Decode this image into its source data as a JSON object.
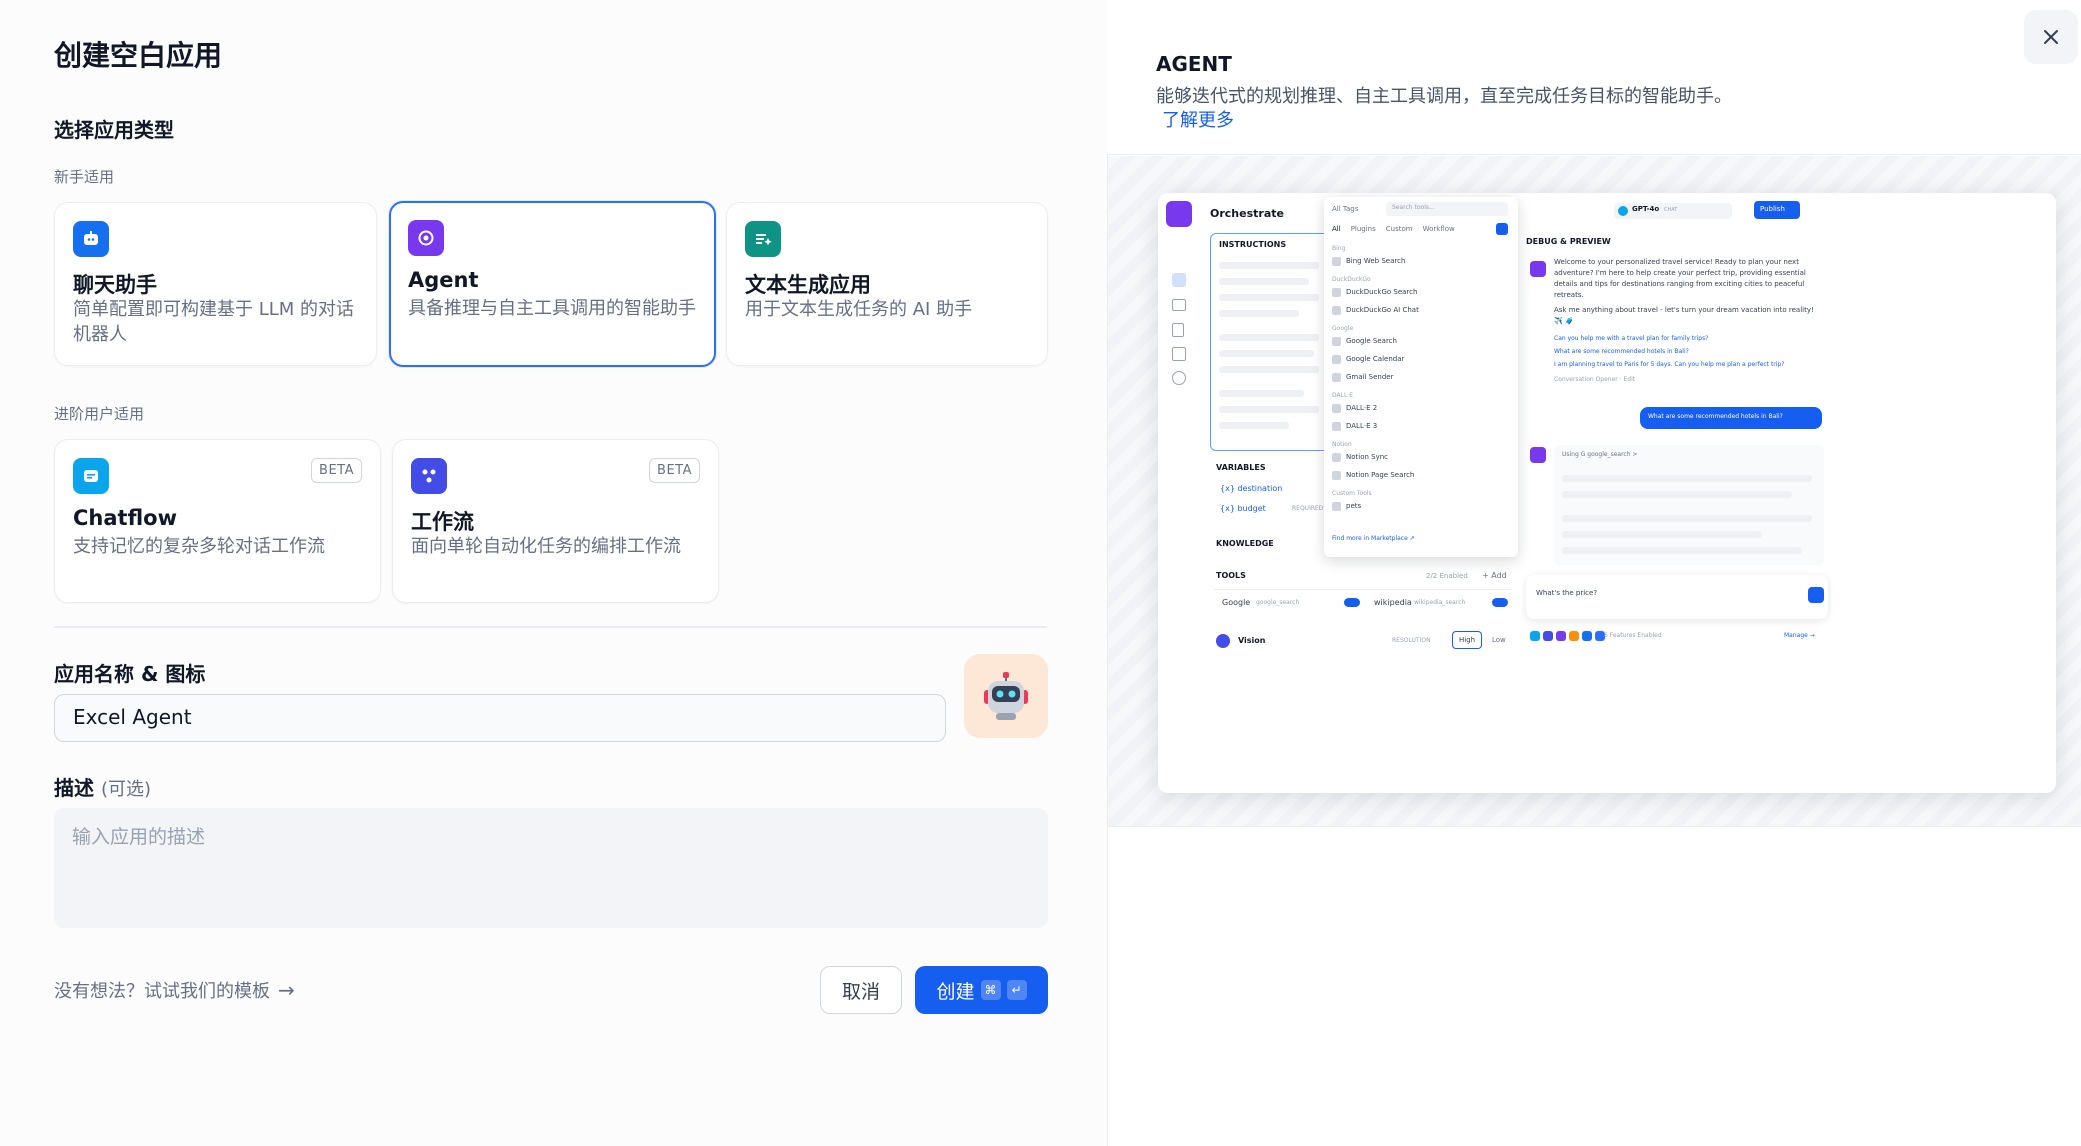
{
  "dialog": {
    "title": "创建空白应用",
    "section_type": "选择应用类型",
    "group_beginner": "新手适用",
    "group_advanced": "进阶用户适用",
    "cards": [
      {
        "name": "聊天助手",
        "desc": "简单配置即可构建基于 LLM 的对话机器人",
        "icon": "chat-bot-icon",
        "color": "#1570ef"
      },
      {
        "name": "Agent",
        "desc": "具备推理与自主工具调用的智能助手",
        "icon": "agent-icon",
        "color": "#7839ee"
      },
      {
        "name": "文本生成应用",
        "desc": "用于文本生成任务的 AI 助手",
        "icon": "text-generation-icon",
        "color": "#0e9384"
      },
      {
        "name": "Chatflow",
        "desc": "支持记忆的复杂多轮对话工作流",
        "icon": "chatflow-icon",
        "color": "#0ba5ec",
        "badge": "BETA"
      },
      {
        "name": "工作流",
        "desc": "面向单轮自动化任务的编排工作流",
        "icon": "workflow-icon",
        "color": "#444ce7",
        "badge": "BETA"
      }
    ],
    "name_label": "应用名称 & 图标",
    "name_value": "Excel Agent",
    "desc_label": "描述",
    "desc_optional": "(可选)",
    "desc_placeholder": "输入应用的描述",
    "template_link": "没有想法？试试我们的模板",
    "cancel": "取消",
    "create": "创建"
  },
  "preview": {
    "title": "AGENT",
    "desc": "能够迭代式的规划推理、自主工具调用，直至完成任务目标的智能助手。",
    "learn_more": "了解更多",
    "shot": {
      "app_title": "Orchestrate",
      "instructions": "INSTRUCTIONS",
      "variables": "VARIABLES",
      "var1": "{x} destination",
      "var2": "{x} budget",
      "required": "REQUIRED",
      "knowledge": "KNOWLEDGE",
      "tools": "TOOLS",
      "tools_enabled": "2/2 Enabled",
      "add": "+ Add",
      "tool1": "Google",
      "tool1_id": "google_search",
      "tool2": "wikipedia",
      "tool2_id": "wikipedia_search",
      "vision": "Vision",
      "resolution": "RESOLUTION",
      "high": "High",
      "low": "Low",
      "tags": "All Tags",
      "search": "Search tools...",
      "tabs": [
        "All",
        "Plugins",
        "Custom",
        "Workflow"
      ],
      "tool_groups": [
        {
          "group": "Bing",
          "items": [
            "Bing Web Search"
          ]
        },
        {
          "group": "DuckDuckGo",
          "items": [
            "DuckDuckGo Search",
            "DuckDuckGo AI Chat"
          ]
        },
        {
          "group": "Google",
          "items": [
            "Google Search",
            "Google Calendar",
            "Gmail Sender"
          ]
        },
        {
          "group": "DALL·E",
          "items": [
            "DALL·E 2",
            "DALL·E 3"
          ]
        },
        {
          "group": "Notion",
          "items": [
            "Notion Sync",
            "Notion Page Search"
          ]
        },
        {
          "group": "Custom Tools",
          "items": [
            "pets"
          ]
        }
      ],
      "marketplace": "Find more in Marketplace ↗",
      "model": "GPT-4o",
      "model_tag": "CHAT",
      "publish": "Publish",
      "debug": "DEBUG & PREVIEW",
      "welcome": "Welcome to your personalized travel service! Ready to plan your next adventure? I'm here to help create your perfect trip, providing essential details and tips for destinations ranging from exciting cities to peaceful retreats.",
      "ask": "Ask me anything about travel - let's turn your dream vacation into reality! ✈️ 🧳",
      "sugg1": "Can you help me with a travel plan for family trips?",
      "sugg2": "What are some recommended hotels in Bali?",
      "sugg3": "I am planning travel to Paris for 5 days. Can you help me plan a perfect trip?",
      "opener": "Conversation Opener · Edit",
      "user_msg": "What are some recommended hotels in Bali?",
      "using": "Using G google_search >",
      "chat_input": "What's the price?",
      "features": "6 Features Enabled",
      "manage": "Manage →"
    }
  }
}
